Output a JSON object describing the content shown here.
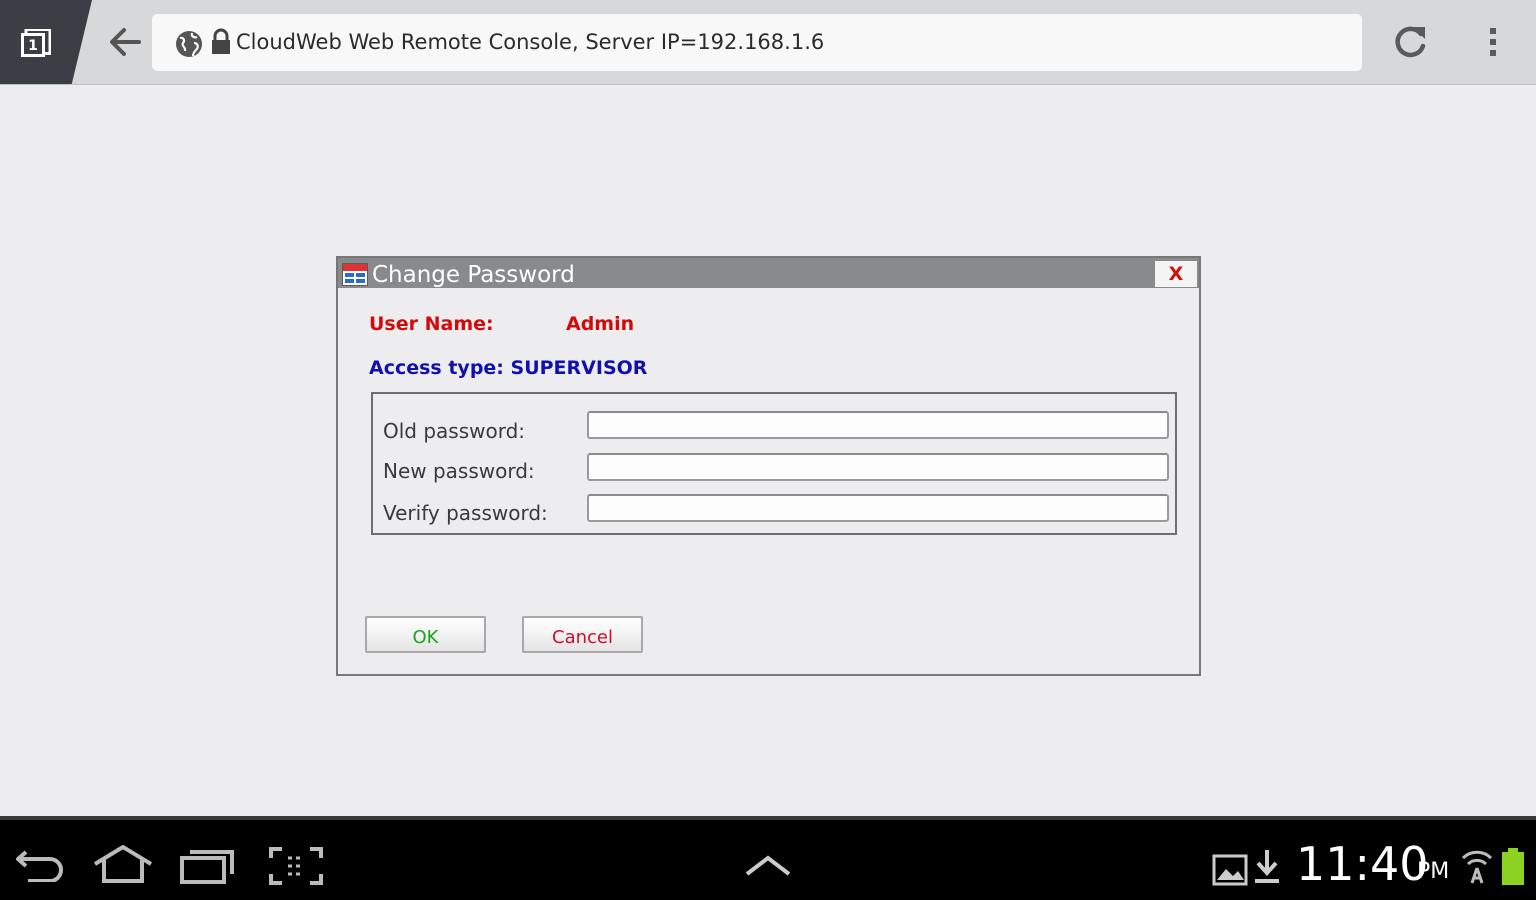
{
  "browser": {
    "tab_count": "1",
    "url": "CloudWeb Web Remote Console, Server IP=192.168.1.6"
  },
  "dialog": {
    "title": "Change Password",
    "close_label": "X",
    "user_name_label": "User Name:",
    "user_name_value": "Admin",
    "access_type": "Access type: SUPERVISOR",
    "fields": [
      {
        "label": "Old password:",
        "value": ""
      },
      {
        "label": "New password:",
        "value": ""
      },
      {
        "label": "Verify password:",
        "value": ""
      }
    ],
    "ok_label": "OK",
    "cancel_label": "Cancel"
  },
  "status_bar": {
    "time": "11:40",
    "ampm": "PM"
  }
}
